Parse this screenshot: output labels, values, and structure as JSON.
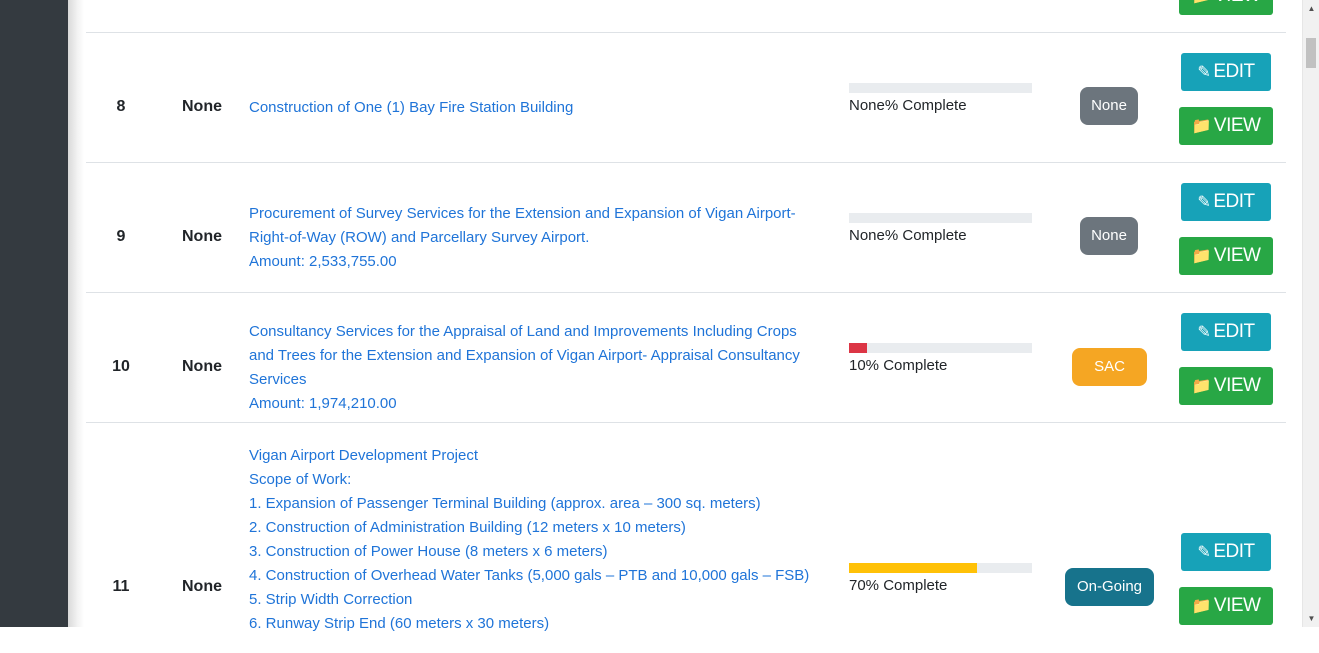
{
  "rows": [
    {
      "num": "8",
      "col2": "None",
      "desc": [
        "Construction of One (1) Bay Fire Station Building"
      ],
      "progress_pct": null,
      "progress_text": "None% Complete",
      "status": "None",
      "status_color": "#6c757d"
    },
    {
      "num": "9",
      "col2": "None",
      "desc": [
        "Procurement of Survey Services for the Extension and Expansion of Vigan Airport-",
        "Right-of-Way (ROW) and Parcellary Survey Airport.",
        "Amount: 2,533,755.00"
      ],
      "progress_pct": null,
      "progress_text": "None% Complete",
      "status": "None",
      "status_color": "#6c757d"
    },
    {
      "num": "10",
      "col2": "None",
      "desc": [
        "Consultancy Services for the Appraisal of Land and Improvements Including Crops",
        "and Trees for the Extension and Expansion of Vigan Airport- Appraisal Consultancy",
        "Services",
        "Amount: 1,974,210.00"
      ],
      "progress_pct": 10,
      "progress_color": "#dc3545",
      "progress_text": "10% Complete",
      "status": "SAC",
      "status_color": "#f5a623"
    },
    {
      "num": "11",
      "col2": "None",
      "desc": [
        "Vigan Airport Development Project",
        "Scope of Work:",
        "1. Expansion of Passenger Terminal Building (approx. area – 300 sq. meters)",
        "2. Construction of Administration Building (12 meters x 10 meters)",
        "3. Construction of Power House (8 meters x 6 meters)",
        "4. Construction of Overhead Water Tanks (5,000 gals – PTB and 10,000 gals – FSB)",
        "5. Strip Width Correction",
        "6. Runway Strip End (60 meters x 30 meters)"
      ],
      "progress_pct": 70,
      "progress_color": "#ffc107",
      "progress_text": "70% Complete",
      "status": "On-Going",
      "status_color": "#17738c"
    }
  ],
  "buttons": {
    "edit": "EDIT",
    "view": "VIEW"
  },
  "icons": {
    "edit": "edit-icon",
    "view": "folder-icon"
  }
}
